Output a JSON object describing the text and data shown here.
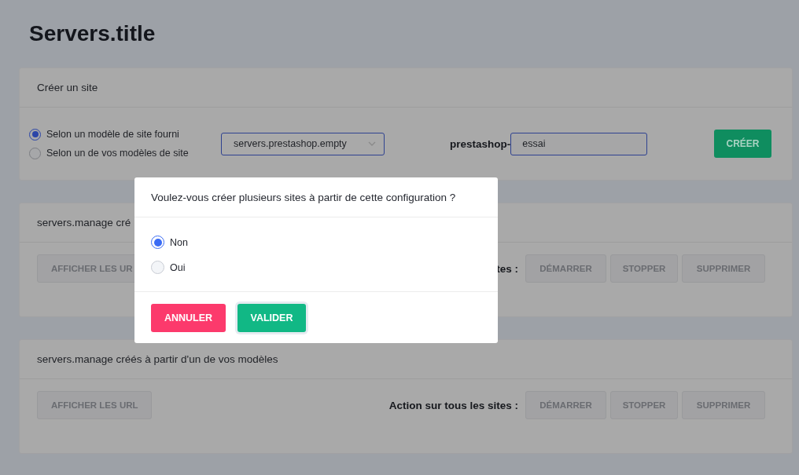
{
  "page_title": "Servers.title",
  "create_card": {
    "title": "Créer un site",
    "options": [
      {
        "label": "Selon un modèle de site fourni",
        "selected": true
      },
      {
        "label": "Selon un de vos modèles de site",
        "selected": false
      }
    ],
    "template_select": {
      "value": "servers.prestashop.empty"
    },
    "name_prefix": "prestashop-",
    "name_field": {
      "value": "essai"
    },
    "create_button": {
      "label": "CRÉER",
      "disabled": false
    }
  },
  "sections": [
    {
      "title": "servers.manage cré",
      "url_button": {
        "label": "AFFICHER LES UR",
        "disabled": true
      },
      "actions_label": "tes :",
      "actions": [
        {
          "label": "DÉMARRER",
          "disabled": true
        },
        {
          "label": "STOPPER",
          "disabled": true
        },
        {
          "label": "SUPPRIMER",
          "disabled": true
        }
      ]
    },
    {
      "title": "servers.manage créés à partir d'un de vos modèles",
      "url_button": {
        "label": "AFFICHER LES URL",
        "disabled": true
      },
      "actions_label": "Action sur tous les sites :",
      "actions": [
        {
          "label": "DÉMARRER",
          "disabled": true
        },
        {
          "label": "STOPPER",
          "disabled": true
        },
        {
          "label": "SUPPRIMER",
          "disabled": true
        }
      ]
    }
  ],
  "dialog": {
    "question": "Voulez-vous créer plusieurs sites à partir de cette configuration ?",
    "options": [
      {
        "label": "Non",
        "selected": true
      },
      {
        "label": "Oui",
        "selected": false
      }
    ],
    "buttons": [
      {
        "label": "ANNULER",
        "kind": "cancel"
      },
      {
        "label": "VALIDER",
        "kind": "confirm"
      }
    ]
  }
}
